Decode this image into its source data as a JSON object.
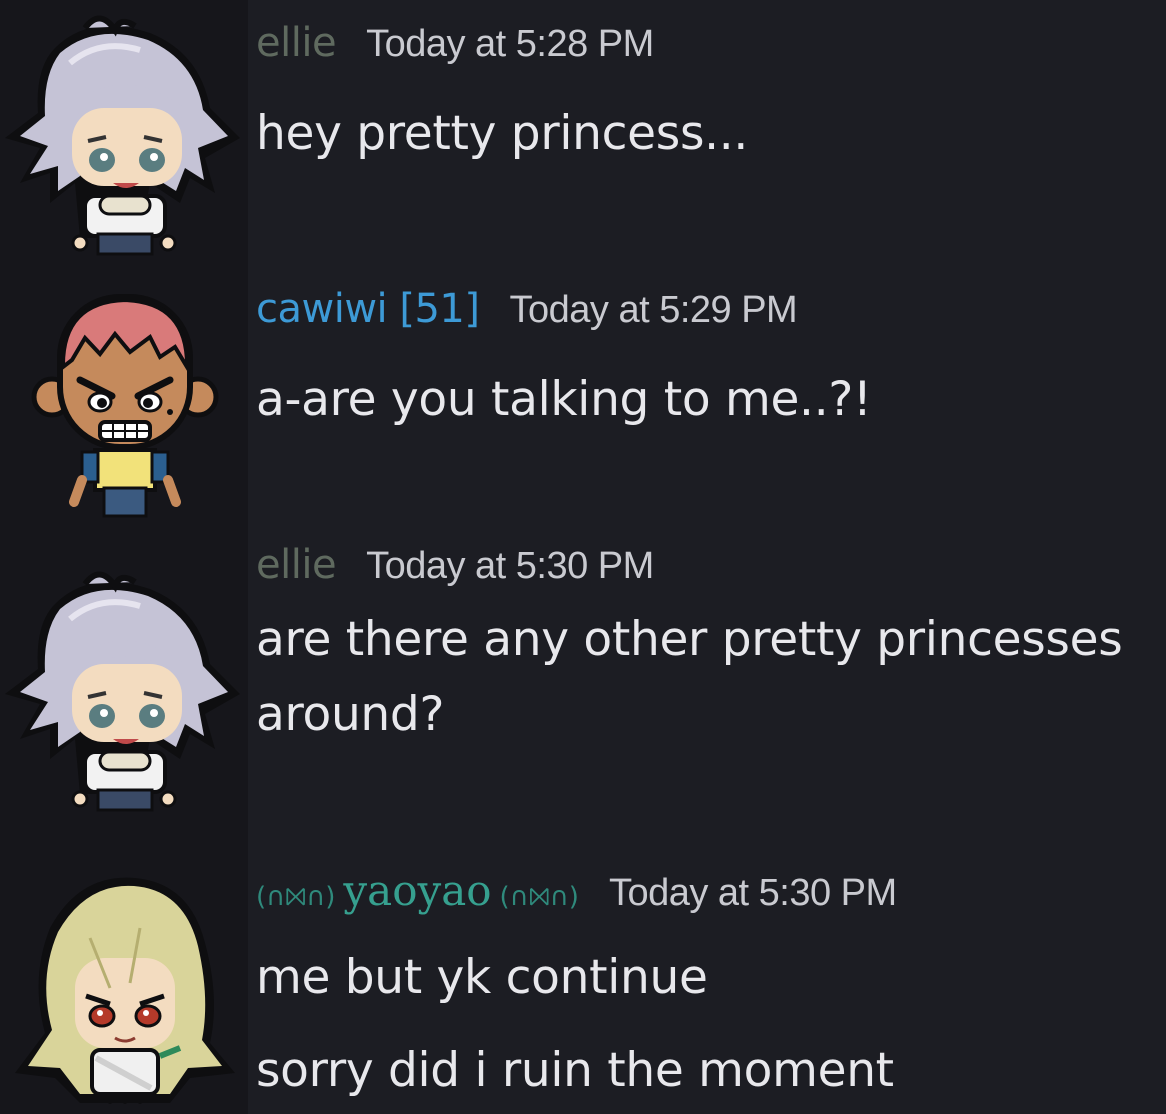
{
  "colors": {
    "background": "#1c1d23",
    "ellie": "#5f6a5f",
    "cawiwi": "#3d9ad6",
    "yaoyao": "#36a08f",
    "timestamp": "#c9cad0",
    "message_text": "#e8e8ec"
  },
  "messages": [
    {
      "avatar": "white-haired-chibi-avatar",
      "username": "ellie",
      "timestamp": "Today at 5:28 PM",
      "lines": [
        "hey pretty princess..."
      ]
    },
    {
      "avatar": "pink-haired-chibi-avatar",
      "username": "cawiwi [51]",
      "timestamp": "Today at 5:29 PM",
      "lines": [
        "a-are you talking to me..?!"
      ]
    },
    {
      "avatar": "white-haired-chibi-avatar",
      "username": "ellie",
      "timestamp": "Today at 5:30 PM",
      "lines": [
        "are there any other pretty princesses",
        "around?"
      ]
    },
    {
      "avatar": "blonde-chibi-avatar",
      "username_prefix": "(∩⨝∩)",
      "username": "yaoyao",
      "username_suffix": "(∩⨝∩)",
      "timestamp": "Today at 5:30 PM",
      "lines": [
        "me but yk continue",
        "sorry did i ruin the moment"
      ]
    }
  ]
}
